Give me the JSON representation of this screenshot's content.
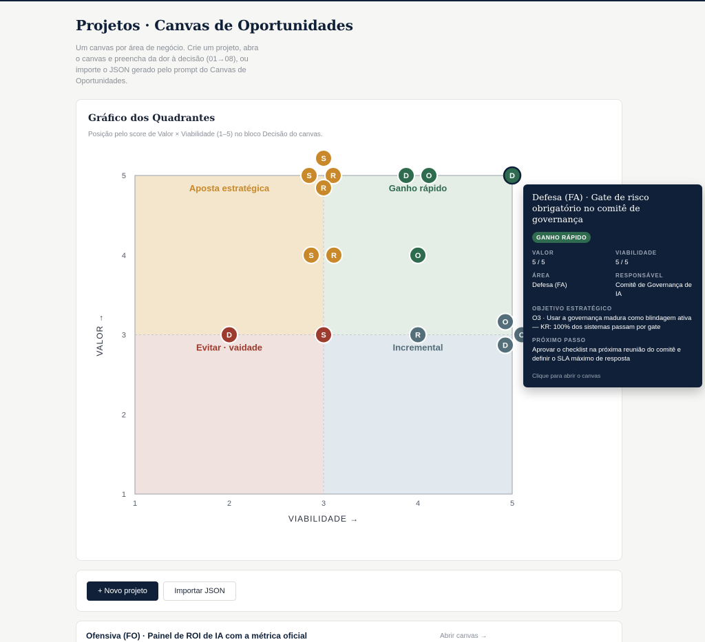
{
  "header": {
    "title": "Projetos · Canvas de Oportunidades",
    "description": "Um canvas por área de negócio. Crie um projeto, abra o canvas e preencha da dor à decisão (01→08), ou importe o JSON gerado pelo prompt do Canvas de Oportunidades."
  },
  "chart_card": {
    "title": "Gráfico dos Quadrantes",
    "subtitle": "Posição pelo score de Valor × Viabilidade (1–5) no bloco Decisão do canvas."
  },
  "chart_data": {
    "type": "scatter",
    "xlabel": "VIABILIDADE →",
    "ylabel": "VALOR →",
    "xlim": [
      1,
      5
    ],
    "ylim": [
      1,
      5
    ],
    "x_ticks": [
      "1",
      "2",
      "3",
      "4",
      "5"
    ],
    "y_ticks": [
      "1",
      "2",
      "3",
      "4",
      "5"
    ],
    "quadrants": [
      {
        "name": "Aposta estratégica",
        "color": "#c9892a",
        "fill": "#f3e6cc"
      },
      {
        "name": "Ganho rápido",
        "color": "#2f6b4f",
        "fill": "#e5eee6"
      },
      {
        "name": "Evitar · vaidade",
        "color": "#9c3b2e",
        "fill": "#f0e2de"
      },
      {
        "name": "Incremental",
        "color": "#546e7a",
        "fill": "#e2e9ee"
      }
    ],
    "points": [
      {
        "label": "S",
        "x": 3,
        "y": 5
      },
      {
        "label": "S",
        "x": 3,
        "y": 5
      },
      {
        "label": "R",
        "x": 3,
        "y": 5
      },
      {
        "label": "R",
        "x": 3,
        "y": 5
      },
      {
        "label": "D",
        "x": 4,
        "y": 5
      },
      {
        "label": "O",
        "x": 4,
        "y": 5
      },
      {
        "label": "D",
        "x": 5,
        "y": 5,
        "selected": true
      },
      {
        "label": "S",
        "x": 3,
        "y": 4
      },
      {
        "label": "R",
        "x": 3,
        "y": 4
      },
      {
        "label": "O",
        "x": 4,
        "y": 4
      },
      {
        "label": "D",
        "x": 2,
        "y": 3
      },
      {
        "label": "S",
        "x": 3,
        "y": 3
      },
      {
        "label": "R",
        "x": 4,
        "y": 3
      },
      {
        "label": "O",
        "x": 5,
        "y": 3
      },
      {
        "label": "D",
        "x": 5,
        "y": 3
      },
      {
        "label": "O",
        "x": 5,
        "y": 3
      }
    ]
  },
  "tooltip": {
    "title": "Defesa (FA) · Gate de risco obrigatório no comitê de governança",
    "badge": "GANHO RÁPIDO",
    "valor_label": "VALOR",
    "valor": "5 / 5",
    "viabilidade_label": "VIABILIDADE",
    "viabilidade": "5 / 5",
    "area_label": "ÁREA",
    "area": "Defesa (FA)",
    "responsavel_label": "RESPONSÁVEL",
    "responsavel": "Comitê de Governança de IA",
    "objetivo_label": "OBJETIVO ESTRATÉGICO",
    "objetivo": "O3 · Usar a governança madura como blindagem ativa — KR: 100% dos sistemas passam por gate",
    "proximo_label": "PRÓXIMO PASSO",
    "proximo": "Aprovar o checklist na próxima reunião do comitê e definir o SLA máximo de resposta",
    "hint": "Clique para abrir o canvas"
  },
  "actions": {
    "new_project": "+ Novo projeto",
    "import_json": "Importar JSON"
  },
  "project": {
    "title": "Ofensiva (FO) · Painel de ROI de IA com a métrica oficial",
    "open_link": "Abrir canvas →"
  },
  "colors": {
    "navy": "#0f2038",
    "gold": "#c9892a",
    "green": "#2f6b4f",
    "red": "#9c3b2e",
    "slate": "#546e7a"
  }
}
